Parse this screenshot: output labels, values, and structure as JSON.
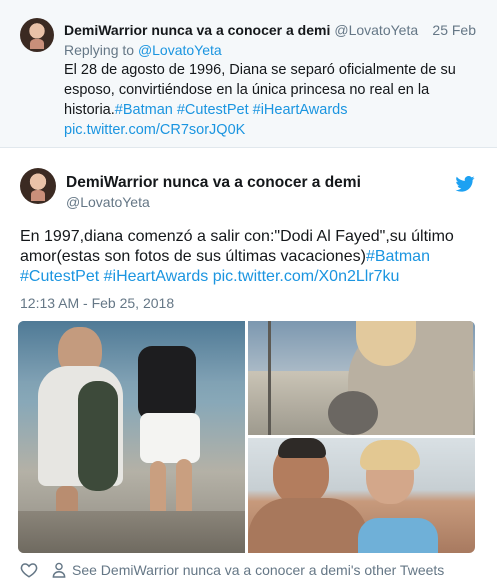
{
  "parent_tweet": {
    "display_name": "DemiWarrior nunca va a conocer a demi",
    "handle": "@LovatoYeta",
    "date": "25 Feb",
    "replying_label": "Replying to",
    "replying_handle": "@LovatoYeta",
    "text_plain": "El 28 de agosto de 1996, Diana se separó oficialmente de su esposo, convirtiéndose en la única princesa no real en la historia.",
    "hashtags": [
      "#Batman",
      "#CutestPet",
      "#iHeartAwards"
    ],
    "link": "pic.twitter.com/CR7sorJQ0K"
  },
  "main_tweet": {
    "display_name": "DemiWarrior nunca va a conocer a demi",
    "handle": "@LovatoYeta",
    "text_plain": "En 1997,diana comenzó a salir con:\"Dodi Al Fayed\",su último amor(estas son fotos de sus últimas vacaciones)",
    "hashtags": [
      "#Batman",
      "#CutestPet",
      "#iHeartAwards"
    ],
    "link": "pic.twitter.com/X0n2Llr7ku",
    "timestamp": "12:13 AM - Feb 25, 2018",
    "brand_icon": "twitter-bird-icon",
    "brand_color": "#1da1f2"
  },
  "actions": {
    "like_icon": "heart-icon",
    "profile_icon": "person-icon",
    "other_tweets": "See DemiWarrior nunca va a conocer a demi's other Tweets"
  },
  "colors": {
    "link": "#1b95e0",
    "secondary": "#657786",
    "parent_bg": "#f5f8fa"
  }
}
